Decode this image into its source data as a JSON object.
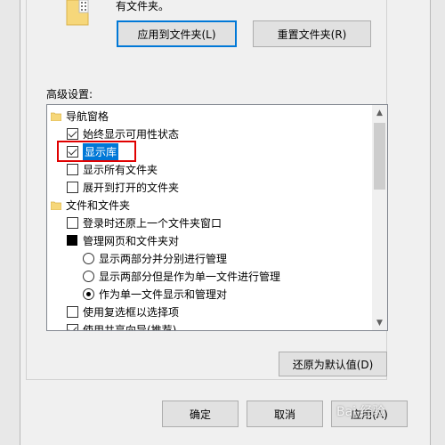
{
  "top": {
    "description_fragment": "有文件夹。",
    "apply_button": "应用到文件夹(L)",
    "reset_button": "重置文件夹(R)"
  },
  "advanced": {
    "label": "高级设置:",
    "items": [
      {
        "type": "folder",
        "label": "导航窗格"
      },
      {
        "type": "checkbox",
        "checked": true,
        "label": "始终显示可用性状态"
      },
      {
        "type": "checkbox",
        "checked": true,
        "label": "显示库",
        "highlighted": true
      },
      {
        "type": "checkbox",
        "checked": false,
        "label": "显示所有文件夹"
      },
      {
        "type": "checkbox",
        "checked": false,
        "label": "展开到打开的文件夹"
      },
      {
        "type": "folder",
        "label": "文件和文件夹"
      },
      {
        "type": "checkbox",
        "checked": false,
        "label": "登录时还原上一个文件夹窗口"
      },
      {
        "type": "group",
        "label": "管理网页和文件夹对"
      },
      {
        "type": "radio",
        "checked": false,
        "label": "显示两部分并分别进行管理"
      },
      {
        "type": "radio",
        "checked": false,
        "label": "显示两部分但是作为单一文件进行管理"
      },
      {
        "type": "radio",
        "checked": true,
        "label": "作为单一文件显示和管理对"
      },
      {
        "type": "checkbox",
        "checked": false,
        "label": "使用复选框以选择项"
      },
      {
        "type": "checkbox",
        "checked": true,
        "label": "使用共享向导(推荐)"
      }
    ]
  },
  "restore_defaults_button": "还原为默认值(D)",
  "footer": {
    "ok_button": "确定",
    "cancel_button": "取消",
    "apply_button": "应用(A)"
  },
  "watermark": "Bai 经验",
  "colors": {
    "highlight": "#0078d7",
    "annotation": "#e00000"
  }
}
